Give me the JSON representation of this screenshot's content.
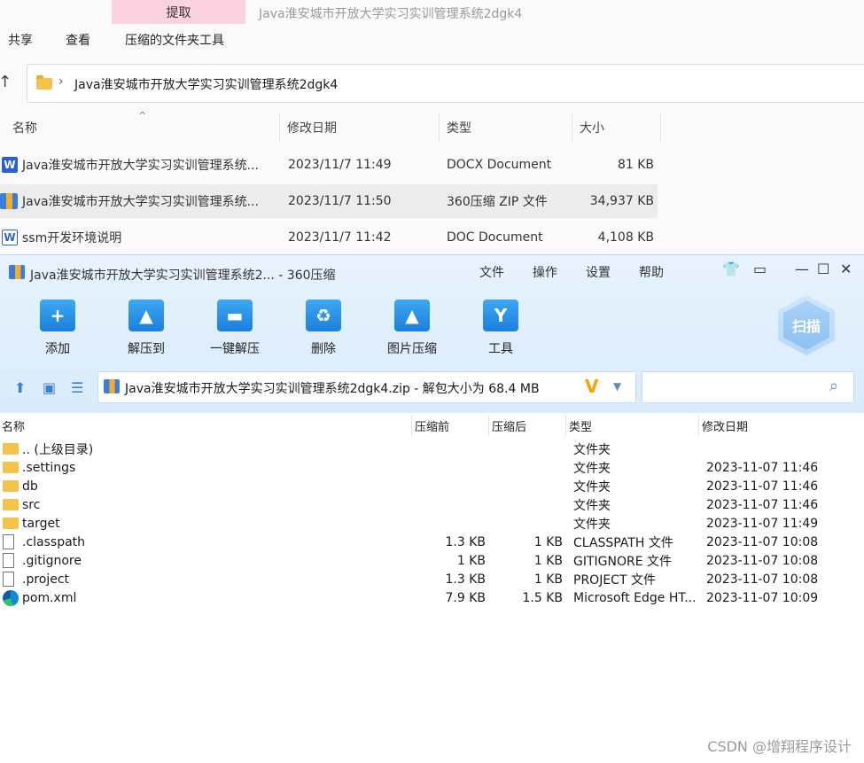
{
  "explorer": {
    "tab_extract": "提取",
    "title": "Java淮安城市开放大学实习实训管理系统2dgk4",
    "ribbon": [
      "共享",
      "查看",
      "压缩的文件夹工具"
    ],
    "address": "Java淮安城市开放大学实习实训管理系统2dgk4",
    "columns": [
      "名称",
      "修改日期",
      "类型",
      "大小"
    ],
    "files": [
      {
        "name": "Java淮安城市开放大学实习实训管理系统...",
        "date": "2023/11/7 11:49",
        "type": "DOCX Document",
        "size": "81 KB",
        "icon": "word-icon"
      },
      {
        "name": "Java淮安城市开放大学实习实训管理系统...",
        "date": "2023/11/7 11:50",
        "type": "360压缩 ZIP 文件",
        "size": "34,937 KB",
        "icon": "zip-icon"
      },
      {
        "name": "ssm开发环境说明",
        "date": "2023/11/7 11:42",
        "type": "DOC Document",
        "size": "4,108 KB",
        "icon": "word-icon"
      }
    ]
  },
  "zip": {
    "title": "Java淮安城市开放大学实习实训管理系统2... - 360压缩",
    "menu": [
      "文件",
      "操作",
      "设置",
      "帮助"
    ],
    "toolbar": [
      {
        "label": "添加",
        "icon": "add-icon",
        "glyph": "+"
      },
      {
        "label": "解压到",
        "icon": "extract-to-icon",
        "glyph": "▲"
      },
      {
        "label": "一键解压",
        "icon": "one-click-extract-icon",
        "glyph": "▬"
      },
      {
        "label": "删除",
        "icon": "delete-icon",
        "glyph": "♻"
      },
      {
        "label": "图片压缩",
        "icon": "image-compress-icon",
        "glyph": "▲"
      },
      {
        "label": "工具",
        "icon": "tools-icon",
        "glyph": "Y"
      }
    ],
    "scan_label": "扫描",
    "path_text": "Java淮安城市开放大学实习实训管理系统2dgk4.zip - 解包大小为 68.4 MB",
    "path_badge": "V",
    "columns": [
      "名称",
      "压缩前",
      "压缩后",
      "类型",
      "修改日期"
    ],
    "entries": [
      {
        "name": ".. (上级目录)",
        "before": "",
        "after": "",
        "type": "文件夹",
        "date": "",
        "icon": "folder"
      },
      {
        "name": ".settings",
        "before": "",
        "after": "",
        "type": "文件夹",
        "date": "2023-11-07 11:46",
        "icon": "folder"
      },
      {
        "name": "db",
        "before": "",
        "after": "",
        "type": "文件夹",
        "date": "2023-11-07 11:46",
        "icon": "folder"
      },
      {
        "name": "src",
        "before": "",
        "after": "",
        "type": "文件夹",
        "date": "2023-11-07 11:46",
        "icon": "folder"
      },
      {
        "name": "target",
        "before": "",
        "after": "",
        "type": "文件夹",
        "date": "2023-11-07 11:49",
        "icon": "folder"
      },
      {
        "name": ".classpath",
        "before": "1.3 KB",
        "after": "1 KB",
        "type": "CLASSPATH 文件",
        "date": "2023-11-07 10:08",
        "icon": "file"
      },
      {
        "name": ".gitignore",
        "before": "1 KB",
        "after": "1 KB",
        "type": "GITIGNORE 文件",
        "date": "2023-11-07 10:08",
        "icon": "file"
      },
      {
        "name": ".project",
        "before": "1.3 KB",
        "after": "1 KB",
        "type": "PROJECT 文件",
        "date": "2023-11-07 10:08",
        "icon": "file"
      },
      {
        "name": "pom.xml",
        "before": "7.9 KB",
        "after": "1.5 KB",
        "type": "Microsoft Edge HT...",
        "date": "2023-11-07 10:09",
        "icon": "edge"
      }
    ]
  },
  "watermark": "CSDN @增翔程序设计"
}
